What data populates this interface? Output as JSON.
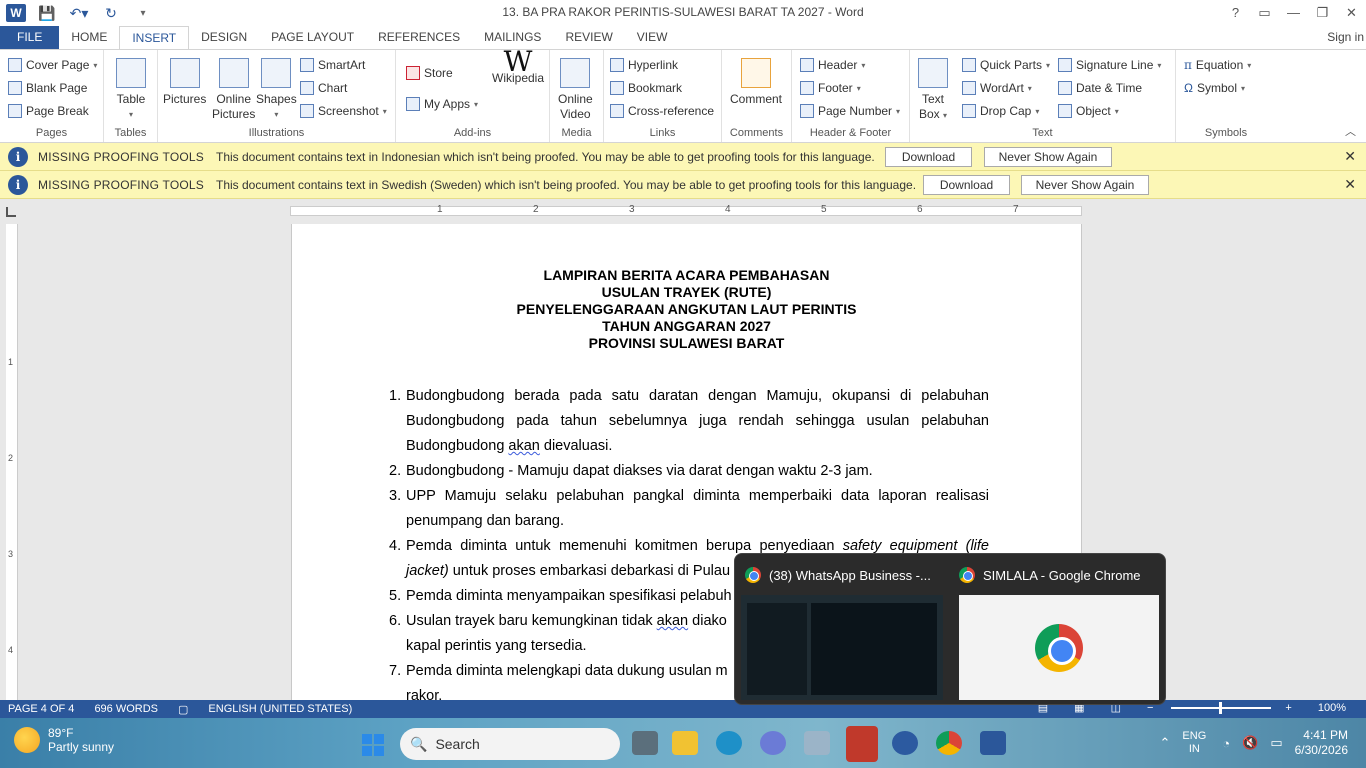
{
  "window": {
    "title": "13. BA PRA RAKOR PERINTIS-SULAWESI BARAT TA 2027 - Word",
    "help": "?",
    "restore_ribbon": "▭",
    "minimize": "—",
    "maximize": "❐",
    "close": "✕"
  },
  "tabs": [
    "FILE",
    "HOME",
    "INSERT",
    "DESIGN",
    "PAGE LAYOUT",
    "REFERENCES",
    "MAILINGS",
    "REVIEW",
    "VIEW"
  ],
  "active_tab": "INSERT",
  "signin": "Sign in",
  "ribbon": {
    "pages": {
      "label": "Pages",
      "cover_page": "Cover Page",
      "blank_page": "Blank Page",
      "page_break": "Page Break"
    },
    "tables": {
      "label": "Tables",
      "table": "Table"
    },
    "illustrations": {
      "label": "Illustrations",
      "pictures": "Pictures",
      "online_pictures_1": "Online",
      "online_pictures_2": "Pictures",
      "shapes": "Shapes",
      "smartart": "SmartArt",
      "chart": "Chart",
      "screenshot": "Screenshot"
    },
    "addins": {
      "label": "Add-ins",
      "store": "Store",
      "my_apps": "My Apps",
      "wikipedia": "Wikipedia",
      "wiki_glyph": "W"
    },
    "media": {
      "label": "Media",
      "online_video_1": "Online",
      "online_video_2": "Video"
    },
    "links": {
      "label": "Links",
      "hyperlink": "Hyperlink",
      "bookmark": "Bookmark",
      "cross_reference": "Cross-reference"
    },
    "comments": {
      "label": "Comments",
      "comment": "Comment"
    },
    "header_footer": {
      "label": "Header & Footer",
      "header": "Header",
      "footer": "Footer",
      "page_number": "Page Number"
    },
    "text": {
      "label": "Text",
      "text_box_1": "Text",
      "text_box_2": "Box",
      "quick_parts": "Quick Parts",
      "wordart": "WordArt",
      "drop_cap": "Drop Cap",
      "signature_line": "Signature Line",
      "date_time": "Date & Time",
      "object": "Object"
    },
    "symbols": {
      "label": "Symbols",
      "equation": "Equation",
      "symbol": "Symbol"
    }
  },
  "infobars": [
    {
      "title": "MISSING PROOFING TOOLS",
      "message": "This document contains text in Indonesian which isn't being proofed. You may be able to get proofing tools for this language.",
      "download": "Download",
      "never": "Never Show Again"
    },
    {
      "title": "MISSING PROOFING TOOLS",
      "message": "This document contains text in Swedish (Sweden) which isn't being proofed. You may be able to get proofing tools for this language.",
      "download": "Download",
      "never": "Never Show Again"
    }
  ],
  "ruler": [
    "1",
    "2",
    "3",
    "4",
    "5",
    "6",
    "7"
  ],
  "vruler": [
    "1",
    "2",
    "3",
    "4"
  ],
  "document": {
    "heading": [
      "LAMPIRAN BERITA ACARA PEMBAHASAN",
      "USULAN TRAYEK (RUTE)",
      "PENYELENGGARAAN ANGKUTAN LAUT PERINTIS",
      "TAHUN ANGGARAN 2027",
      "PROVINSI SULAWESI BARAT"
    ],
    "items": [
      {
        "num": "1.",
        "line1": "Budongbudong berada pada satu daratan dengan Mamuju, okupansi di pelabuhan",
        "line2": "Budongbudong pada tahun sebelumnya juga rendah sehingga usulan pelabuhan",
        "line3a": "Budongbudong ",
        "line3b": "akan",
        "line3c": " dievaluasi."
      },
      {
        "num": "2.",
        "line1": "Budongbudong - Mamuju dapat diakses via darat dengan waktu 2-3 jam."
      },
      {
        "num": "3.",
        "line1": "UPP Mamuju selaku pelabuhan pangkal diminta memperbaiki data laporan realisasi",
        "line2": "penumpang dan barang."
      },
      {
        "num": "4.",
        "line1a": "Pemda diminta untuk memenuhi komitmen berupa penyediaan ",
        "line1b": "safety equipment (life",
        "line2a": "jacket)",
        "line2b": " untuk proses embarkasi debarkasi di Pulau"
      },
      {
        "num": "5.",
        "line1": "Pemda diminta menyampaikan spesifikasi pelabuh"
      },
      {
        "num": "6.",
        "line1a": "Usulan trayek baru kemungkinan tidak ",
        "line1b": "akan",
        "line1c": " diako",
        "line2": "kapal perintis yang tersedia."
      },
      {
        "num": "7.",
        "line1": "Pemda diminta melengkapi data dukung usulan m",
        "line2": "rakor."
      }
    ]
  },
  "status": {
    "page": "PAGE 4 OF 4",
    "words": "696 WORDS",
    "language": "ENGLISH (UNITED STATES)",
    "zoom": "100%",
    "zoom_minus": "−",
    "zoom_plus": "+"
  },
  "preview": {
    "item1": "(38) WhatsApp Business -...",
    "item2": "SIMLALA - Google Chrome"
  },
  "taskbar": {
    "temp": "89°F",
    "weather": "Partly sunny",
    "search": "Search",
    "lang1": "ENG",
    "lang2": "IN",
    "time": "4:41 PM",
    "date": "6/30/2026"
  }
}
